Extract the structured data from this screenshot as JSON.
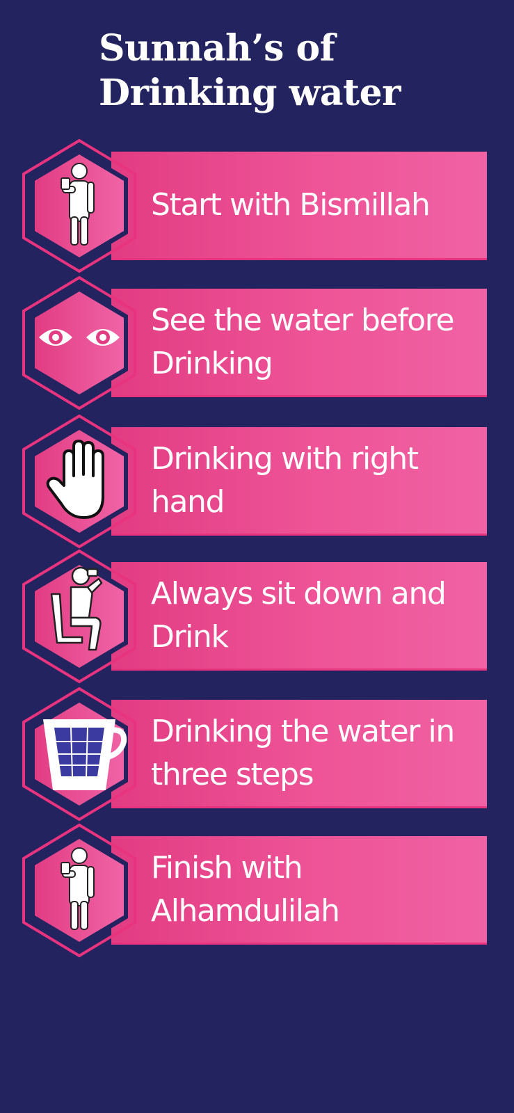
{
  "title": {
    "line1": "Sunnah’s of",
    "line2": "Drinking water"
  },
  "colors": {
    "background": "#232360",
    "card_pink": "#ee5497",
    "accent": "#e8337e",
    "text": "#ffffff"
  },
  "items": [
    {
      "label": "Start with Bismillah",
      "icon": "person-holding-cup-icon"
    },
    {
      "label": "See the water before Drinking",
      "icon": "eyes-icon"
    },
    {
      "label": "Drinking with right hand",
      "icon": "hand-icon"
    },
    {
      "label": "Always sit down and Drink",
      "icon": "sitting-drinking-person-icon"
    },
    {
      "label": "Drinking the water in three steps",
      "icon": "cup-three-steps-icon"
    },
    {
      "label": "Finish with Alhamdulilah",
      "icon": "person-holding-cup-icon"
    }
  ]
}
